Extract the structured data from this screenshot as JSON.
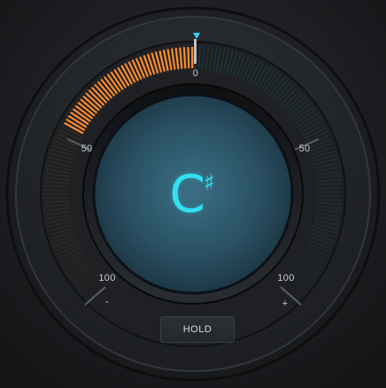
{
  "tuner": {
    "note_letter": "C",
    "note_accidental": "♯",
    "cents_offset_display": -47,
    "scale": {
      "top_label": "0",
      "left_mid_label": "50",
      "right_mid_label": "50",
      "left_low_label": "100",
      "right_low_label": "100",
      "minus_label": "-",
      "plus_label": "+"
    },
    "hold_label": "HOLD"
  },
  "colors": {
    "flat_orange": "#ff8c2e",
    "sharp_cyan": "#2aa9b8",
    "pointer_cyan": "#33d0f0",
    "note_cyan": "#33e0f2"
  }
}
